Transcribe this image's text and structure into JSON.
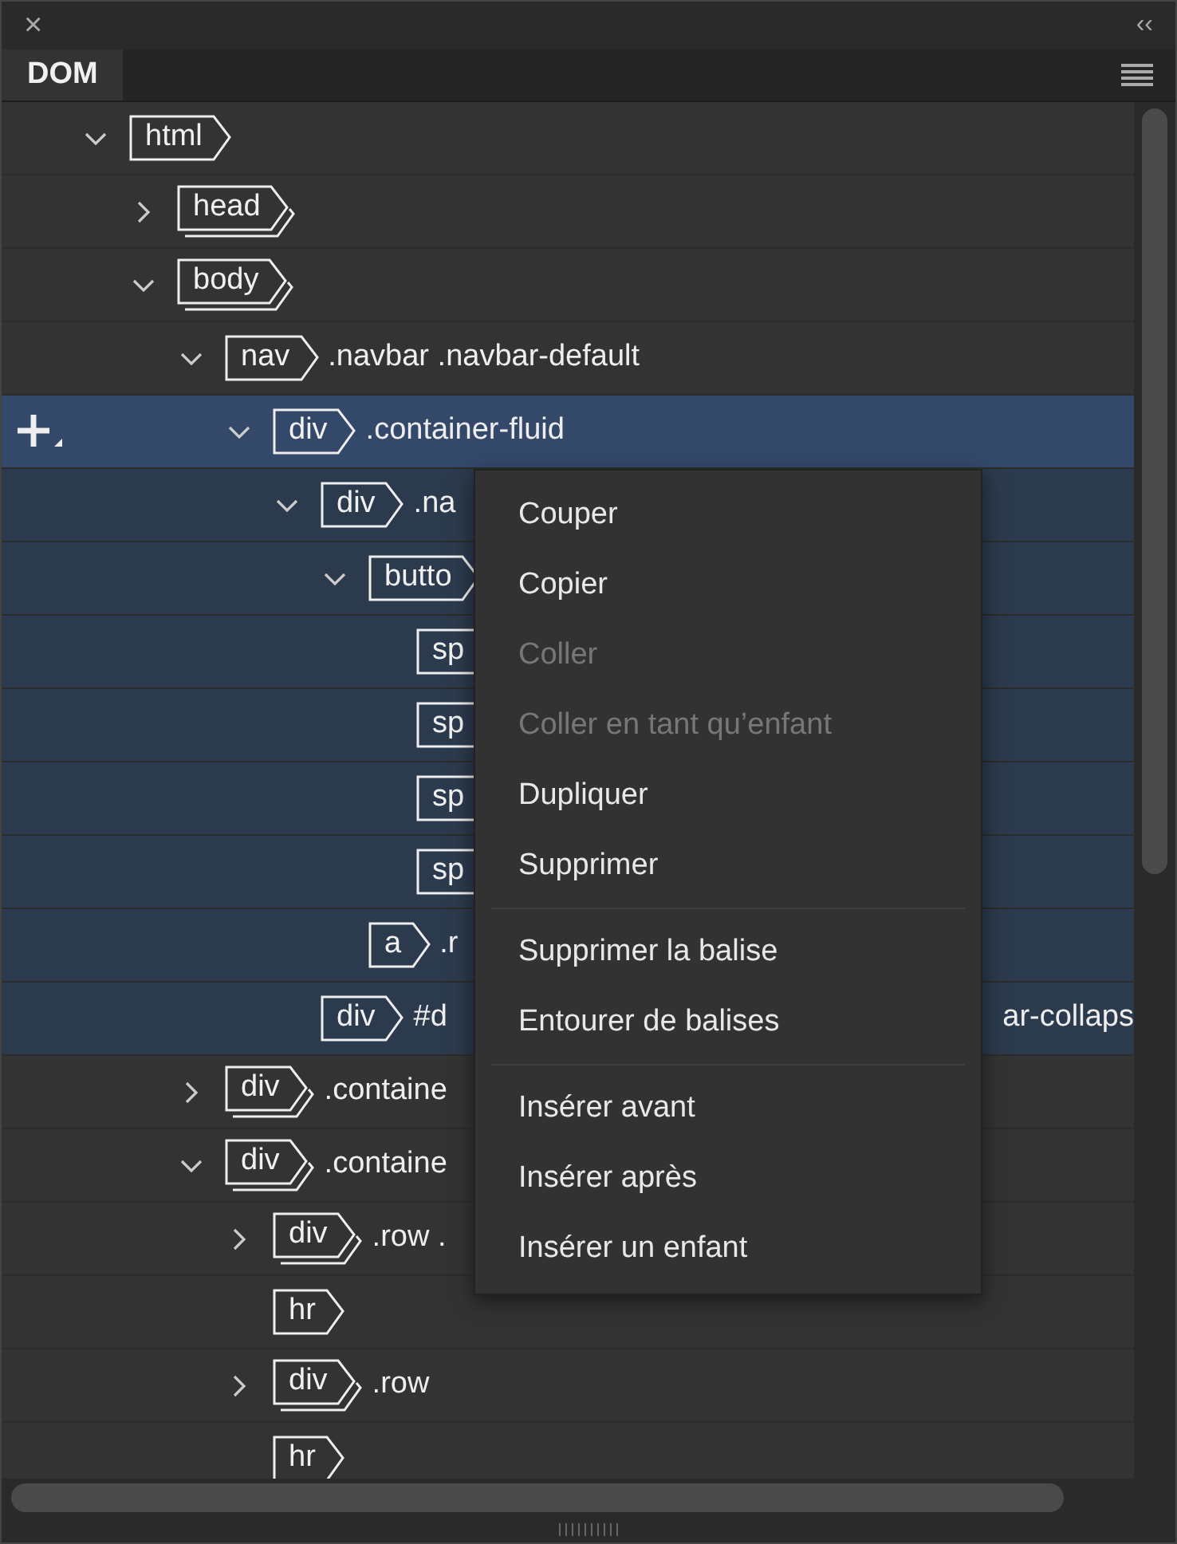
{
  "panel": {
    "close": "×",
    "collapse": "‹‹"
  },
  "tabs": [
    {
      "label": "DOM",
      "selected": true
    }
  ],
  "tree": [
    {
      "tag": "html",
      "expanded": true,
      "stacked": false,
      "children": [
        {
          "tag": "head",
          "expanded": false,
          "stacked": true
        },
        {
          "tag": "body",
          "expanded": true,
          "stacked": true,
          "children": [
            {
              "tag": "nav",
              "classes": ".navbar .navbar-default",
              "expanded": true,
              "stacked": false,
              "children": [
                {
                  "tag": "div",
                  "classes": ".container-fluid",
                  "expanded": true,
                  "stacked": false,
                  "selected": true,
                  "children": [
                    {
                      "tag": "div",
                      "classes": ".na",
                      "expanded": true,
                      "stacked": false,
                      "children": [
                        {
                          "tag": "butto",
                          "expanded": true,
                          "stacked": false,
                          "children": [
                            {
                              "tag": "sp",
                              "stacked": false
                            },
                            {
                              "tag": "sp",
                              "stacked": false
                            },
                            {
                              "tag": "sp",
                              "stacked": false
                            },
                            {
                              "tag": "sp",
                              "stacked": false
                            }
                          ]
                        },
                        {
                          "tag": "a",
                          "classes": ".r",
                          "stacked": false
                        }
                      ]
                    },
                    {
                      "tag": "div",
                      "classes": "#d",
                      "tail": "ar-collaps",
                      "stacked": false
                    }
                  ]
                }
              ]
            },
            {
              "tag": "div",
              "classes": ".containe",
              "expanded": false,
              "stacked": true
            },
            {
              "tag": "div",
              "classes": ".containe",
              "expanded": true,
              "stacked": true,
              "children": [
                {
                  "tag": "div",
                  "classes": ".row .",
                  "expanded": false,
                  "stacked": true
                },
                {
                  "tag": "hr",
                  "stacked": false
                },
                {
                  "tag": "div",
                  "classes": ".row",
                  "expanded": false,
                  "stacked": true
                },
                {
                  "tag": "hr",
                  "stacked": false
                }
              ]
            }
          ]
        }
      ]
    }
  ],
  "context_menu": [
    {
      "kind": "item",
      "label": "Couper",
      "disabled": false
    },
    {
      "kind": "item",
      "label": "Copier",
      "disabled": false
    },
    {
      "kind": "item",
      "label": "Coller",
      "disabled": true
    },
    {
      "kind": "item",
      "label": "Coller en tant qu’enfant",
      "disabled": true
    },
    {
      "kind": "item",
      "label": "Dupliquer",
      "disabled": false
    },
    {
      "kind": "item",
      "label": "Supprimer",
      "disabled": false
    },
    {
      "kind": "separator"
    },
    {
      "kind": "item",
      "label": "Supprimer la balise",
      "disabled": false
    },
    {
      "kind": "item",
      "label": "Entourer de balises",
      "disabled": false
    },
    {
      "kind": "separator"
    },
    {
      "kind": "item",
      "label": "Insérer avant",
      "disabled": false
    },
    {
      "kind": "item",
      "label": "Insérer après",
      "disabled": false
    },
    {
      "kind": "item",
      "label": "Insérer un enfant",
      "disabled": false
    }
  ]
}
